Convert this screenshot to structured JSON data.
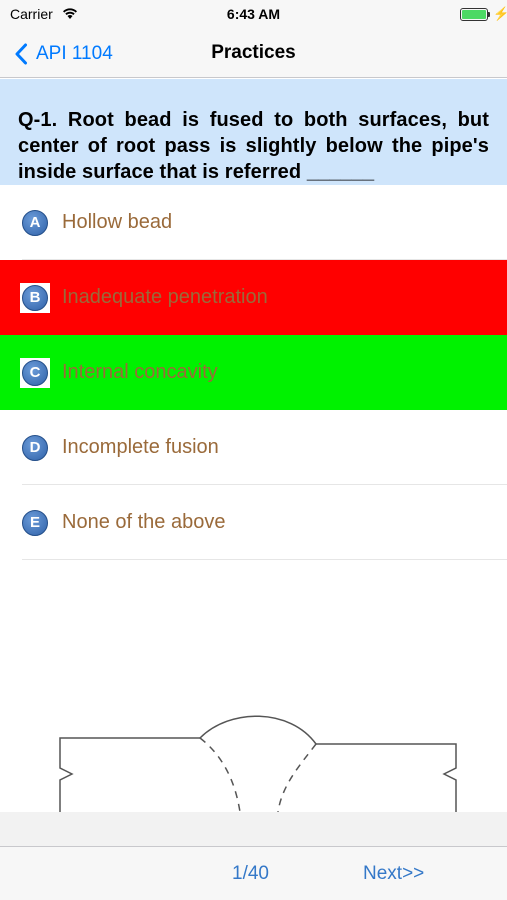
{
  "status_bar": {
    "carrier": "Carrier",
    "time": "6:43 AM",
    "wifi_icon": "wifi-icon",
    "battery_icon": "battery-icon",
    "charging_icon": "charging-bolt-icon"
  },
  "nav": {
    "back_label": "API 1104",
    "back_icon": "chevron-left-icon",
    "title": "Practices"
  },
  "question": {
    "text": "Q-1. Root bead is fused to both surfaces, but center of root pass is slightly below the pipe's inside surface that is referred ______"
  },
  "options": [
    {
      "letter": "A",
      "label": "Hollow bead",
      "state": "neutral"
    },
    {
      "letter": "B",
      "label": "Inadequate penetration",
      "state": "wrong"
    },
    {
      "letter": "C",
      "label": "Internal concavity",
      "state": "correct"
    },
    {
      "letter": "D",
      "label": "Incomplete fusion",
      "state": "neutral"
    },
    {
      "letter": "E",
      "label": "None of the above",
      "state": "neutral"
    }
  ],
  "colors": {
    "wrong": "#ff0000",
    "correct": "#00f200",
    "option_text": "#9a6a3a",
    "accent": "#007aff",
    "question_bg": "#cfe5fb"
  },
  "diagram": {
    "icon": "weld-joint-diagram"
  },
  "toolbar": {
    "page": "1/40",
    "next_label": "Next>>"
  }
}
